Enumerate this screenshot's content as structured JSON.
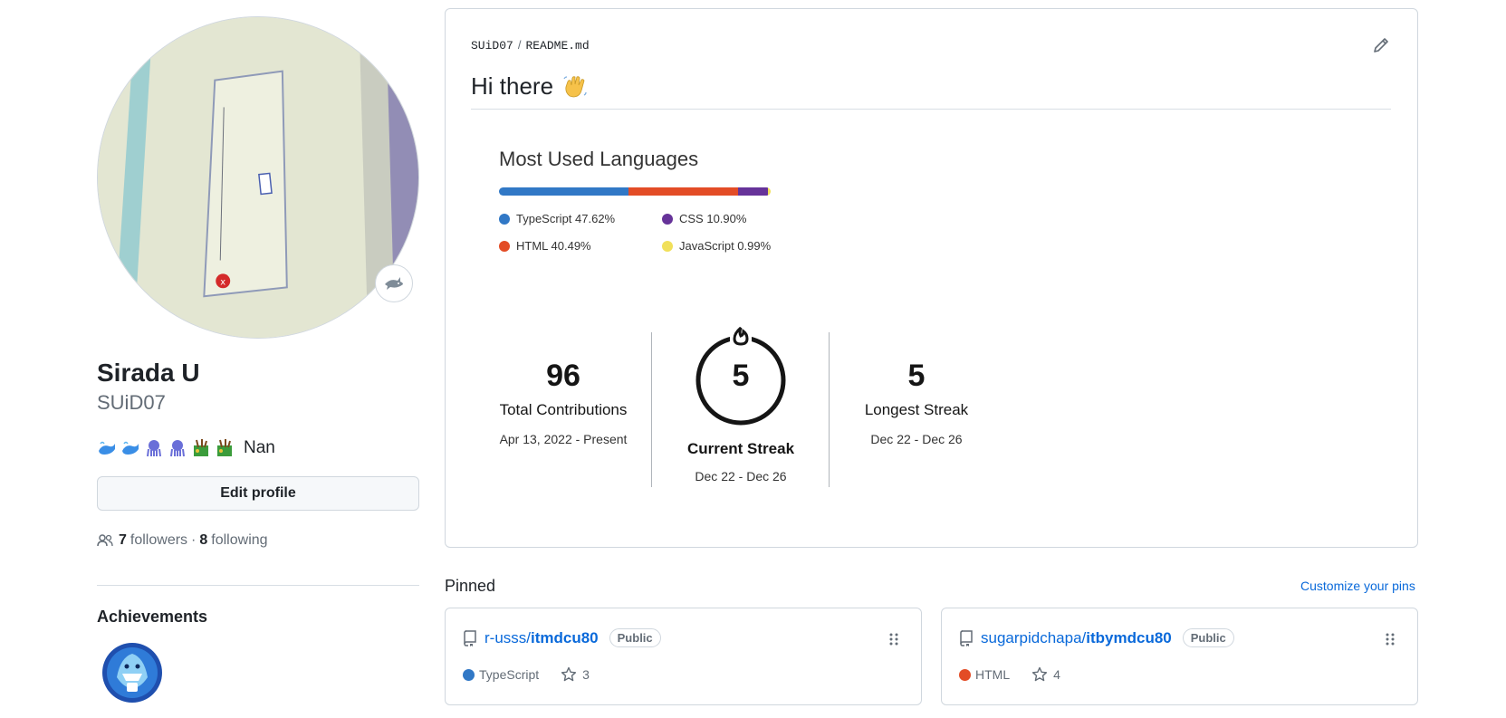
{
  "profile": {
    "name": "Sirada U",
    "login": "SUiD07",
    "bio_text": "Nan",
    "bio_emojis": [
      "whale",
      "whale",
      "octopus",
      "octopus",
      "bamboo",
      "bamboo"
    ],
    "status_emoji": "shark-icon",
    "edit_label": "Edit profile",
    "followers_count": "7",
    "followers_label": "followers",
    "dot": "·",
    "following_count": "8",
    "following_label": "following",
    "achievements_title": "Achievements"
  },
  "readme": {
    "owner": "SUiD07",
    "separator": "/",
    "file": "README.md",
    "heading": "Hi there",
    "heading_emoji": "waving-hand"
  },
  "languages": {
    "title": "Most Used Languages",
    "items": [
      {
        "label": "TypeScript 47.62%",
        "name": "TypeScript",
        "percent": 47.62,
        "color": "#3178c6"
      },
      {
        "label": "HTML 40.49%",
        "name": "HTML",
        "percent": 40.49,
        "color": "#e34c26"
      },
      {
        "label": "CSS 10.90%",
        "name": "CSS",
        "percent": 10.9,
        "color": "#663399"
      },
      {
        "label": "JavaScript 0.99%",
        "name": "JavaScript",
        "percent": 0.99,
        "color": "#f1e05a"
      }
    ]
  },
  "streak": {
    "total": {
      "value": "96",
      "label": "Total Contributions",
      "range": "Apr 13, 2022 - Present"
    },
    "current": {
      "value": "5",
      "label": "Current Streak",
      "range": "Dec 22 - Dec 26"
    },
    "longest": {
      "value": "5",
      "label": "Longest Streak",
      "range": "Dec 22 - Dec 26"
    }
  },
  "pinned": {
    "title": "Pinned",
    "customize_label": "Customize your pins",
    "repos": [
      {
        "owner": "r-usss/",
        "repo": "itmdcu80",
        "visibility": "Public",
        "language": "TypeScript",
        "lang_color": "#3178c6",
        "stars": "3"
      },
      {
        "owner": "sugarpidchapa/",
        "repo": "itbymdcu80",
        "visibility": "Public",
        "language": "HTML",
        "lang_color": "#e34c26",
        "stars": "4"
      }
    ]
  },
  "colors": {
    "link": "#0969da",
    "border": "#d0d7de",
    "muted": "#636c76"
  }
}
